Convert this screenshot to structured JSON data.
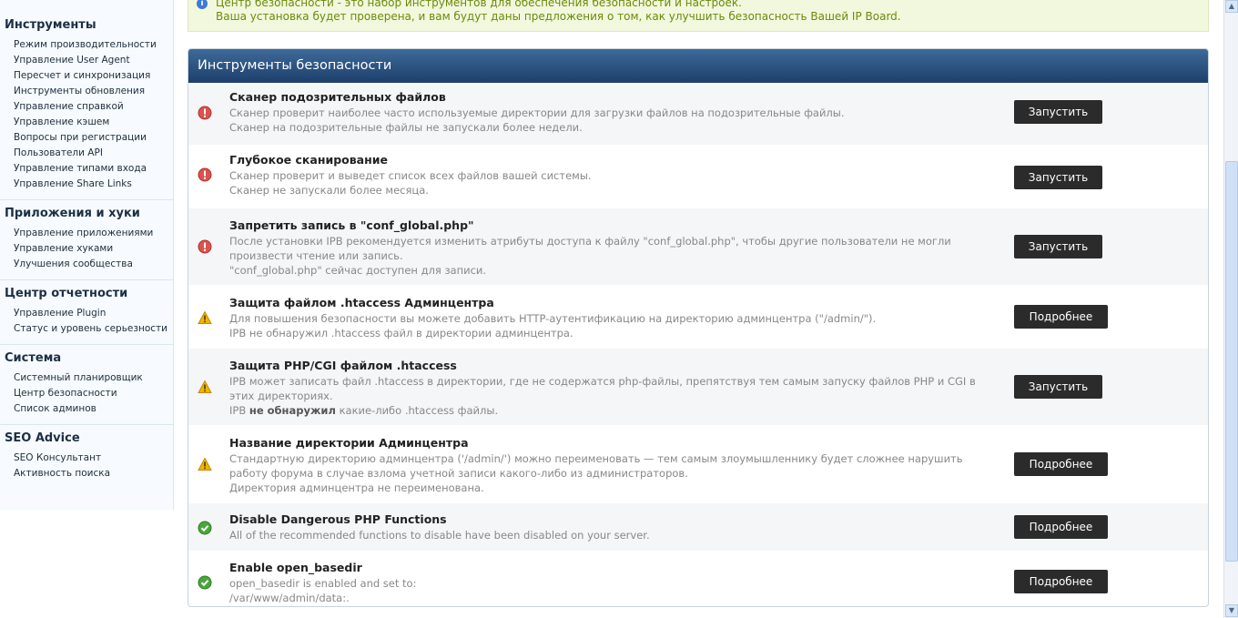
{
  "sidebar": {
    "sections": [
      {
        "title": "Инструменты",
        "items": [
          "Режим производительности",
          "Управление User Agent",
          "Пересчет и синхронизация",
          "Инструменты обновления",
          "Управление справкой",
          "Управление кэшем",
          "Вопросы при регистрации",
          "Пользователи API",
          "Управление типами входа",
          "Управление Share Links"
        ]
      },
      {
        "title": "Приложения и хуки",
        "items": [
          "Управление приложениями",
          "Управление хуками",
          "Улучшения сообщества"
        ]
      },
      {
        "title": "Центр отчетности",
        "items": [
          "Управление Plugin",
          "Статус и уровень серьезности"
        ]
      },
      {
        "title": "Система",
        "items": [
          "Системный планировщик",
          "Центр безопасности",
          "Список админов"
        ]
      },
      {
        "title": "SEO Advice",
        "items": [
          "SEO Консультант",
          "Активность поиска"
        ]
      }
    ]
  },
  "info": {
    "line1": "Центр безопасности - это набор инструментов для обеспечения безопасности и настроек.",
    "line2": "Ваша установка будет проверена, и вам будут даны предложения о том, как улучшить безопасность Вашей IP Board."
  },
  "panel": {
    "title": "Инструменты безопасности",
    "rows": [
      {
        "status": "error",
        "icon": "error-icon",
        "title": "Сканер подозрительных файлов",
        "desc": [
          "Сканер проверит наиболее часто используемые директории для загрузки файлов на подозрительные файлы.",
          "Сканер на подозрительные файлы не запускали более недели."
        ],
        "button": "Запустить"
      },
      {
        "status": "error",
        "icon": "error-icon",
        "title": "Глубокое сканирование",
        "desc": [
          "Сканер проверит и выведет список всех файлов вашей системы.",
          "Сканер не запускали более месяца."
        ],
        "button": "Запустить"
      },
      {
        "status": "error",
        "icon": "error-icon",
        "title": "Запретить запись в \"conf_global.php\"",
        "desc": [
          "После установки IPB рекомендуется изменить атрибуты доступа к файлу \"conf_global.php\", чтобы другие пользователи не могли произвести чтение или запись.",
          "\"conf_global.php\" сейчас доступен для записи."
        ],
        "button": "Запустить"
      },
      {
        "status": "warning",
        "icon": "warning-icon",
        "title": "Защита файлом .htaccess Админцентра",
        "desc": [
          "Для повышения безопасности вы можете добавить HTTP-аутентификацию на директорию админцентра (\"/admin/\").",
          "IPB не обнаружил .htaccess файл в директории админцентра."
        ],
        "button": "Подробнее"
      },
      {
        "status": "warning",
        "icon": "warning-icon",
        "title": "Защита PHP/CGI файлом .htaccess",
        "desc": [
          "IPB может записать файл .htaccess в директории, где не содержатся php-файлы, препятствуя тем самым запуску файлов PHP и CGI в этих директориях."
        ],
        "desc_parts": {
          "pre": "IPB ",
          "bold": "не обнаружил",
          "post": " какие-либо .htaccess файлы."
        },
        "button": "Запустить"
      },
      {
        "status": "warning",
        "icon": "warning-icon",
        "title": "Название директории Админцентра",
        "desc": [
          "Стандартную директорию админцентра ('/admin/') можно переименовать — тем самым злоумышленнику будет сложнее нарушить работу форума в случае взлома учетной записи какого-либо из администраторов.",
          "Директория админцентра не переименована."
        ],
        "button": "Подробнее"
      },
      {
        "status": "ok",
        "icon": "check-icon",
        "title": "Disable Dangerous PHP Functions",
        "desc": [
          "All of the recommended functions to disable have been disabled on your server."
        ],
        "button": "Подробнее"
      },
      {
        "status": "ok",
        "icon": "check-icon",
        "title": "Enable open_basedir",
        "desc": [
          "open_basedir is enabled and set to:",
          "/var/www/admin/data:."
        ],
        "button": "Подробнее"
      }
    ]
  },
  "colors": {
    "error": "#d9534f",
    "warning": "#f0b400",
    "ok": "#4aa63c",
    "header": "#2a4d7b"
  }
}
